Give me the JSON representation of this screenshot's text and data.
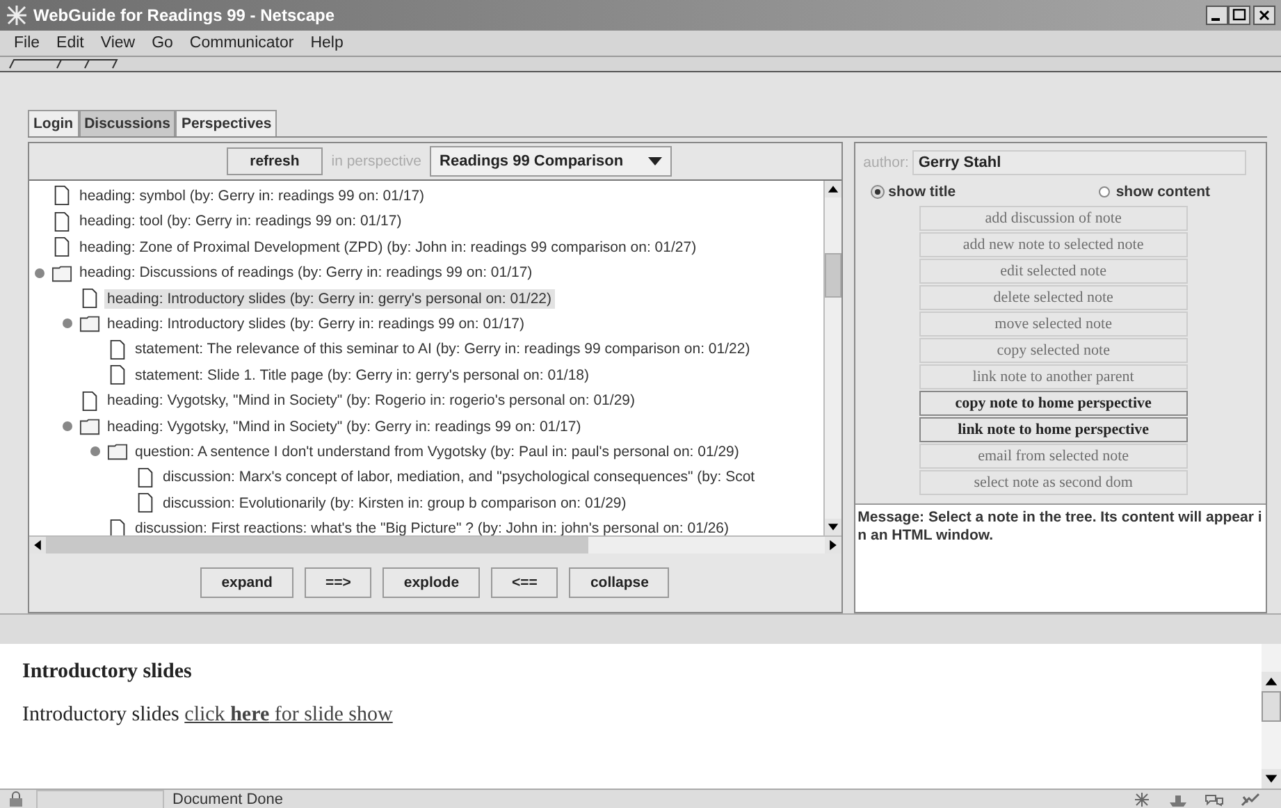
{
  "window": {
    "title": "WebGuide for Readings 99 - Netscape"
  },
  "menu": [
    "File",
    "Edit",
    "View",
    "Go",
    "Communicator",
    "Help"
  ],
  "tabs": [
    {
      "label": "Login",
      "selected": false
    },
    {
      "label": "Discussions",
      "selected": true
    },
    {
      "label": "Perspectives",
      "selected": false
    }
  ],
  "toolbar": {
    "refresh": "refresh",
    "perspective_label": "in perspective",
    "perspective": "Readings 99 Comparison"
  },
  "tree": [
    {
      "kind": "note",
      "text": "heading:  symbol  (by: Gerry in: readings 99 on: 01/17)",
      "selected": false
    },
    {
      "kind": "note",
      "text": "heading:  tool  (by: Gerry in: readings 99 on: 01/17)",
      "selected": false
    },
    {
      "kind": "note",
      "text": "heading:  Zone of Proximal Development (ZPD)  (by: John in: readings 99 comparison on: 01/27)",
      "selected": false
    },
    {
      "kind": "folder",
      "expanded": true,
      "text": "heading:  Discussions of readings  (by: Gerry in: readings 99 on: 01/17)",
      "selected": false,
      "children": [
        {
          "kind": "note",
          "text": "heading:  Introductory slides  (by: Gerry in: gerry's personal on: 01/22)",
          "selected": true
        },
        {
          "kind": "folder",
          "expanded": true,
          "text": "heading:  Introductory slides  (by: Gerry in: readings 99 on: 01/17)",
          "selected": false,
          "children": [
            {
              "kind": "note",
              "text": "statement:  The relevance of this seminar to AI  (by: Gerry in: readings 99 comparison on: 01/22)",
              "selected": false
            },
            {
              "kind": "note",
              "text": "statement:  Slide 1. Title page  (by: Gerry in: gerry's personal on: 01/18)",
              "selected": false
            }
          ]
        },
        {
          "kind": "note",
          "text": "heading:  Vygotsky, \"Mind in Society\"  (by: Rogerio in: rogerio's personal on: 01/29)",
          "selected": false
        },
        {
          "kind": "folder",
          "expanded": true,
          "text": "heading:  Vygotsky, \"Mind in Society\"  (by: Gerry in: readings 99 on: 01/17)",
          "selected": false,
          "children": [
            {
              "kind": "folder",
              "expanded": true,
              "text": "question:  A sentence I don't understand from Vygotsky  (by: Paul in: paul's personal on: 01/29)",
              "selected": false,
              "children": [
                {
                  "kind": "note",
                  "text": "discussion:  Marx's concept of labor, mediation, and \"psychological consequences\"  (by: Scot",
                  "selected": false
                },
                {
                  "kind": "note",
                  "text": "discussion:  Evolutionarily  (by: Kirsten in: group b comparison on: 01/29)",
                  "selected": false
                }
              ]
            },
            {
              "kind": "note",
              "text": "discussion:  First reactions: what's the \"Big Picture\" ?  (by: John in: john's personal on: 01/26)",
              "selected": false
            }
          ]
        }
      ]
    }
  ],
  "tree_buttons": [
    "expand",
    "==>",
    "explode",
    "<==",
    "collapse"
  ],
  "author": {
    "label": "author:",
    "value": "Gerry Stahl"
  },
  "view_options": [
    {
      "label": "show title",
      "selected": true
    },
    {
      "label": "show content",
      "selected": false
    }
  ],
  "actions": [
    {
      "label": "add discussion of note",
      "disabled": true
    },
    {
      "label": "add new note to selected note",
      "disabled": true
    },
    {
      "label": "edit selected note",
      "disabled": true
    },
    {
      "label": "delete selected note",
      "disabled": true
    },
    {
      "label": "move selected note",
      "disabled": true
    },
    {
      "label": "copy selected note",
      "disabled": true
    },
    {
      "label": "link note to another parent",
      "disabled": true
    },
    {
      "label": "copy note to home perspective",
      "disabled": false
    },
    {
      "label": "link note to home perspective",
      "disabled": false
    },
    {
      "label": "email from selected note",
      "disabled": true
    },
    {
      "label": "select note as second dom",
      "disabled": true
    }
  ],
  "message": "Message: Select a note in the tree. Its content will appear in an HTML window.",
  "document": {
    "heading": "Introductory slides",
    "text": "Introductory slides ",
    "link": "click **here** for slide show"
  },
  "status_bar": {
    "text": "Document Done"
  }
}
